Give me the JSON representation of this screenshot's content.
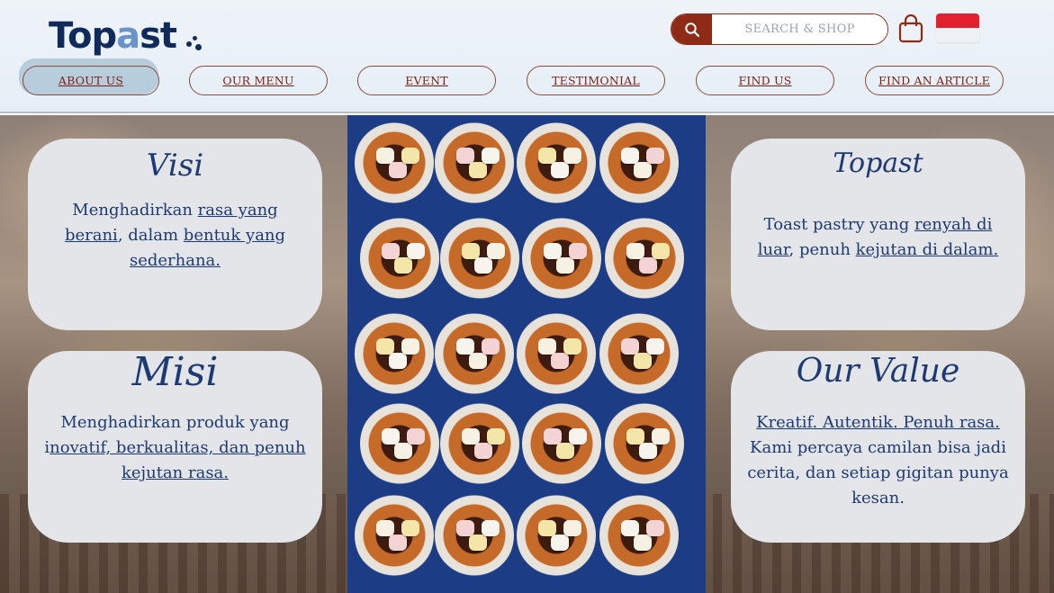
{
  "brand": {
    "name_a": "Top",
    "name_b": "a",
    "name_c": "st"
  },
  "search": {
    "placeholder": "SEARCH & SHOP"
  },
  "nav": {
    "items": [
      {
        "label": "ABOUT US",
        "active": true
      },
      {
        "label": "OUR MENU"
      },
      {
        "label": "EVENT"
      },
      {
        "label": "TESTIMONIAL"
      },
      {
        "label": "FIND US"
      },
      {
        "label": "FIND AN ARTICLE"
      }
    ]
  },
  "cards": {
    "visi": {
      "title": "Visi",
      "p1": "Menghadirkan ",
      "l1": "rasa yang",
      "l2": "berani",
      "p2": ", dalam ",
      "l3": "bentuk yang",
      "l4": "sederhana."
    },
    "topast": {
      "title": "Topast",
      "p1": "Toast pastry yang ",
      "l1": "renyah di",
      "l2": "luar",
      "p2": ", penuh ",
      "l3": "kejutan di dalam."
    },
    "misi": {
      "title": "Misi",
      "p1": "Menghadirkan produk yang",
      "p2": "i",
      "l1": "novatif, berkualitas, dan penuh",
      "l2": "kejutan rasa."
    },
    "value": {
      "title": "Our Value",
      "l1": "Kreatif. Autentik. Penuh rasa.",
      "p1": "Kami percaya camilan bisa jadi",
      "p2": "cerita, dan setiap gigitan punya",
      "p3": "kesan."
    }
  },
  "colors": {
    "brand_navy": "#102a5c",
    "accent_red": "#8e2a16",
    "card_bg": "#e3e5e9",
    "photo_bg": "#1c3d86"
  }
}
